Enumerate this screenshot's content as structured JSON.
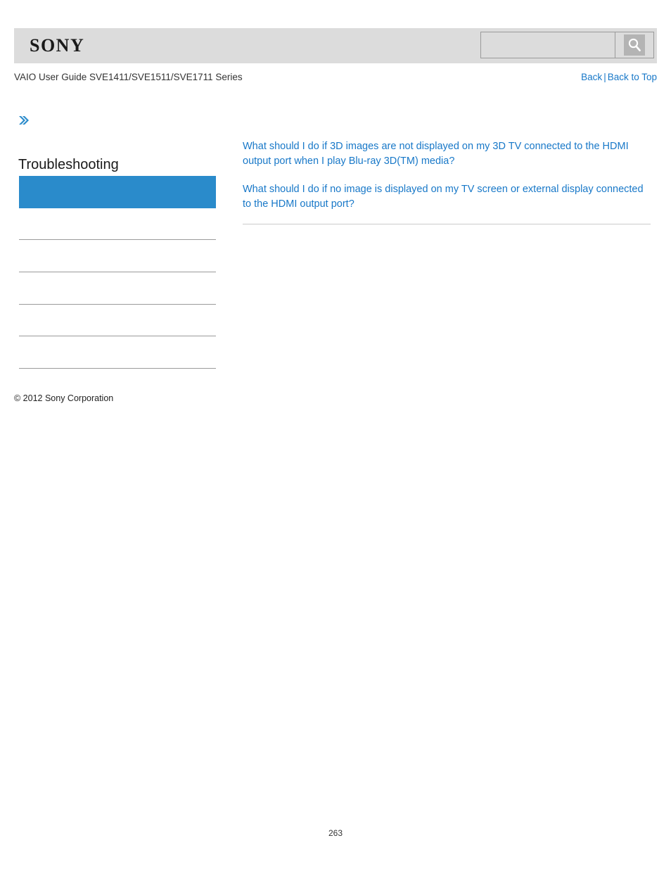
{
  "header": {
    "logo_text": "SONY",
    "guide_title": "VAIO User Guide SVE1411/SVE1511/SVE1711 Series",
    "back_label": "Back",
    "separator": "|",
    "back_to_top_label": "Back to Top",
    "band_color": "#dcdcdc"
  },
  "search": {
    "value": "",
    "placeholder": "",
    "icon": "search-icon",
    "button_label": ""
  },
  "sidebar": {
    "chevron_icon": "double-chevron-right-icon",
    "title": "Troubleshooting",
    "selected_item_label": "",
    "selected_item_color": "#2a8bcb",
    "divider_count": 5,
    "items": [
      {
        "label": ""
      },
      {
        "label": ""
      },
      {
        "label": ""
      },
      {
        "label": ""
      },
      {
        "label": ""
      }
    ]
  },
  "main": {
    "links": [
      {
        "text": "What should I do if 3D images are not displayed on my 3D TV connected to the HDMI output port when I play Blu-ray 3D(TM) media?"
      },
      {
        "text": "What should I do if no image is displayed on my TV screen or external display connected to the HDMI output port?"
      }
    ],
    "link_color": "#1878c8"
  },
  "footer": {
    "copyright": "© 2012 Sony Corporation",
    "page_number": "263"
  }
}
